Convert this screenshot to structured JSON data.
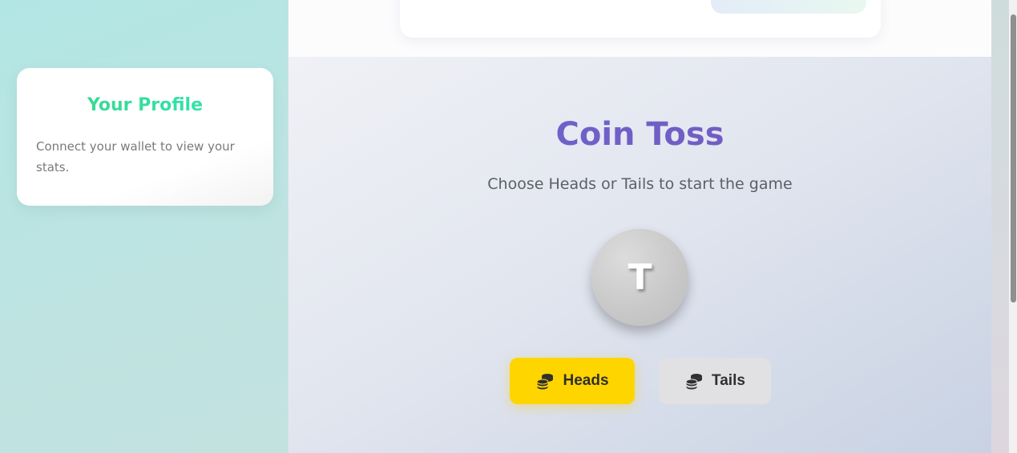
{
  "profile": {
    "title": "Your Profile",
    "message": "Connect your wallet to view your stats."
  },
  "game": {
    "title": "Coin Toss",
    "subtitle": "Choose Heads or Tails to start the game",
    "coin_face": "T",
    "heads_label": "Heads",
    "tails_label": "Tails",
    "heads_icon": "coins-icon",
    "tails_icon": "coins-icon"
  },
  "colors": {
    "heads_button": "#ffd500",
    "tails_button": "#e1e1e3",
    "title_gradient_start": "#6a67d4",
    "profile_title": "#3dd68c"
  }
}
